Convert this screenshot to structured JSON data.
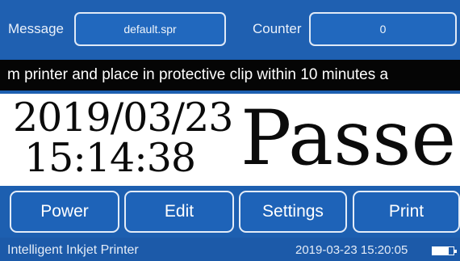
{
  "message": {
    "label": "Message",
    "value": "default.spr"
  },
  "counter": {
    "label": "Counter",
    "value": "0"
  },
  "ticker": "m printer and place in protective clip within 10 minutes a",
  "preview": {
    "date": "2019/03/23",
    "time": "15:14:38",
    "status": "Passe"
  },
  "buttons": {
    "power": "Power",
    "edit": "Edit",
    "settings": "Settings",
    "print": "Print"
  },
  "statusbar": {
    "app_name": "Intelligent Inkjet Printer",
    "datetime": "2019-03-23 15:20:05",
    "battery_icon": "battery-icon",
    "battery_level": 0.78
  },
  "colors": {
    "background": "#1d5fb0",
    "ticker_bg": "#050505",
    "preview_bg": "#ffffff"
  }
}
